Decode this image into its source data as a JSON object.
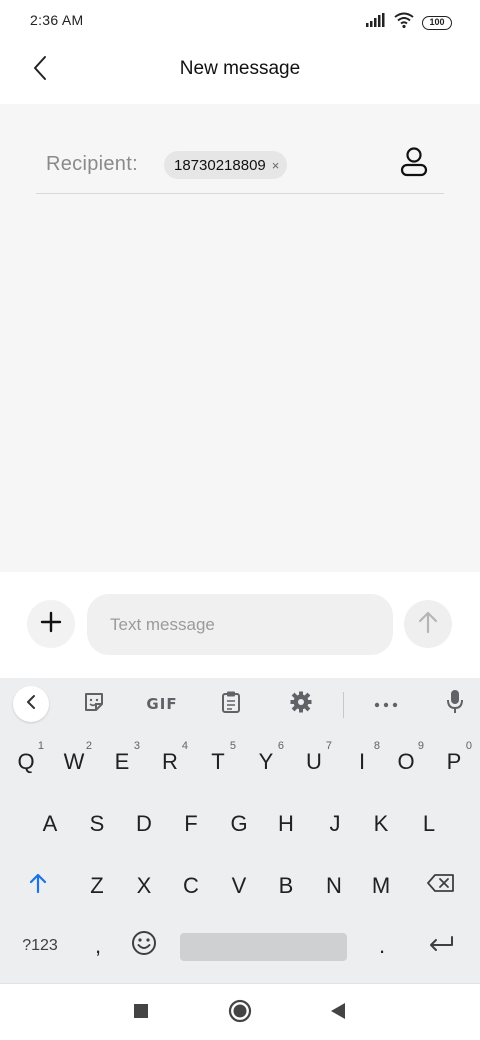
{
  "status_bar": {
    "time": "2:36 AM",
    "battery": "100",
    "icons": [
      "signal-icon",
      "wifi-icon",
      "battery-icon"
    ]
  },
  "header": {
    "title": "New message",
    "back_icon": "chevron-left-icon"
  },
  "recipient": {
    "label": "Recipient:",
    "chip_value": "18730218809",
    "chip_remove": "×",
    "contact_icon": "contact-person-icon"
  },
  "composer": {
    "placeholder": "Text message",
    "value": "",
    "attach_icon": "plus-icon",
    "send_icon": "arrow-up-icon"
  },
  "keyboard": {
    "toolbar": {
      "collapse_icon": "chevron-left-icon",
      "sticker_icon": "sticker-icon",
      "gif_label": "GIF",
      "clipboard_icon": "clipboard-icon",
      "settings_icon": "gear-icon",
      "more_icon": "more-horizontal-icon",
      "mic_icon": "microphone-icon"
    },
    "row1": [
      {
        "key": "Q",
        "hint": "1"
      },
      {
        "key": "W",
        "hint": "2"
      },
      {
        "key": "E",
        "hint": "3"
      },
      {
        "key": "R",
        "hint": "4"
      },
      {
        "key": "T",
        "hint": "5"
      },
      {
        "key": "Y",
        "hint": "6"
      },
      {
        "key": "U",
        "hint": "7"
      },
      {
        "key": "I",
        "hint": "8"
      },
      {
        "key": "O",
        "hint": "9"
      },
      {
        "key": "P",
        "hint": "0"
      }
    ],
    "row2": [
      "A",
      "S",
      "D",
      "F",
      "G",
      "H",
      "J",
      "K",
      "L"
    ],
    "row3": [
      "Z",
      "X",
      "C",
      "V",
      "B",
      "N",
      "M"
    ],
    "row4": {
      "symbols_label": "?123",
      "comma": ",",
      "period": "."
    },
    "accent_color": "#1a73e8"
  },
  "nav": {
    "recents_icon": "square-icon",
    "home_icon": "circle-icon",
    "back_icon": "triangle-back-icon"
  }
}
